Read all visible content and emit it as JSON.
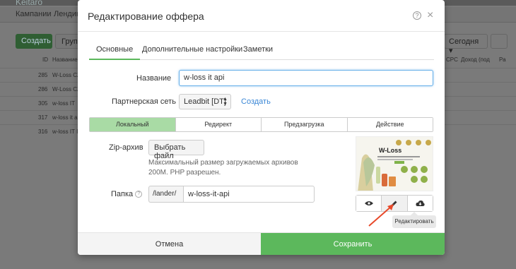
{
  "background": {
    "brand": "Keitaro",
    "nav": [
      "Кампании",
      "Лендинги"
    ],
    "create_btn": "Создать",
    "group_btn": "Групп",
    "date_btn": "Сегодня",
    "columns": [
      "ID",
      "Название",
      "CPC",
      "Доход (под",
      "Ра"
    ],
    "rows": [
      {
        "id": "285",
        "name": "W-Loss CZ"
      },
      {
        "id": "286",
        "name": "W-Loss CZ"
      },
      {
        "id": "305",
        "name": "w-loss IT"
      },
      {
        "id": "317",
        "name": "w-loss it api"
      },
      {
        "id": "316",
        "name": "w-loss IT IV"
      }
    ]
  },
  "modal": {
    "title": "Редактирование оффера",
    "help_symbol": "?",
    "close_symbol": "×",
    "tabs": [
      "Основные",
      "Дополнительные настройки",
      "Заметки"
    ],
    "name_label": "Название",
    "name_value": "w-loss it api",
    "network_label": "Партнерская сеть",
    "network_value": "Leadbit [DT]",
    "network_create": "Создать",
    "types": [
      "Локальный",
      "Редирект",
      "Предзагрузка",
      "Действие"
    ],
    "zip_label": "Zip-архив",
    "file_btn": "Выбрать файл",
    "zip_help": "Максимальный размер загружаемых архивов 200M. PHP разрешен.",
    "folder_label": "Папка",
    "folder_prefix": "/lander/",
    "folder_value": "w-loss-it-api",
    "preview_title": "W-Loss",
    "tooltip": "Редактировать",
    "cancel": "Отмена",
    "save": "Сохранить"
  },
  "icons": {
    "view": "eye-icon",
    "edit": "pencil-icon",
    "download": "cloud-download-icon"
  },
  "colors": {
    "accent": "#5cb85c",
    "segment_active": "#a9dba5",
    "link": "#3a87d6",
    "annotation_arrow": "#e8492a"
  }
}
